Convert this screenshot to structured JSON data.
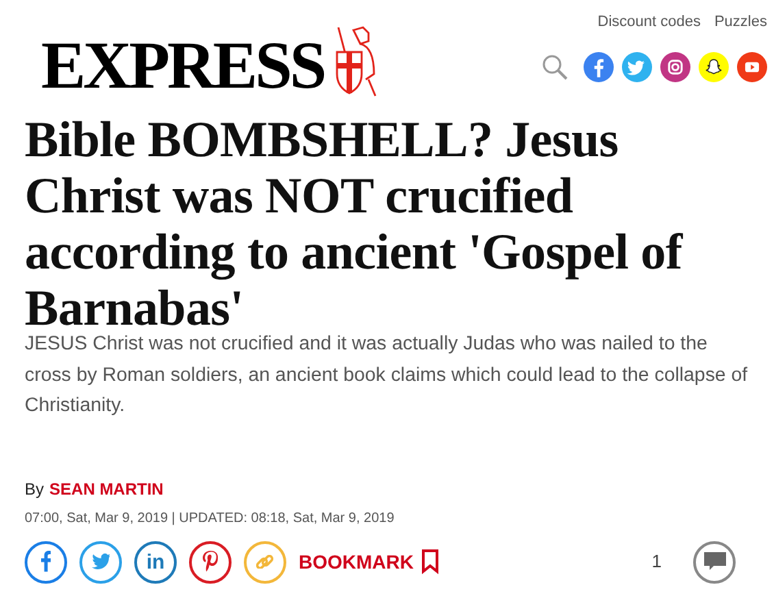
{
  "header": {
    "logo": "EXPRESS",
    "links": [
      "Discount codes",
      "Puzzles"
    ],
    "social": [
      {
        "kind": "facebook",
        "color": "#3b82f0"
      },
      {
        "kind": "twitter",
        "color": "#2fb2ef"
      },
      {
        "kind": "instagram",
        "color": "#c13584"
      },
      {
        "kind": "snapchat",
        "color": "#fffc00"
      },
      {
        "kind": "youtube",
        "color": "#f03a17"
      }
    ]
  },
  "article": {
    "headline": "Bible BOMBSHELL? Jesus Christ was NOT crucified according to ancient 'Gospel of Barnabas'",
    "standfirst": "JESUS Christ was not crucified and it was actually Judas who was nailed to the cross by Roman soldiers, an ancient book claims which could lead to the collapse of Christianity.",
    "byline_prefix": "By",
    "author": "SEAN MARTIN",
    "date": "07:00, Sat, Mar 9, 2019 | UPDATED: 08:18, Sat, Mar 9, 2019",
    "share": [
      {
        "kind": "facebook",
        "color": "#1a7ee6"
      },
      {
        "kind": "twitter",
        "color": "#2ba0e8"
      },
      {
        "kind": "linkedin",
        "color": "#1e7ab8",
        "label": "in"
      },
      {
        "kind": "pinterest",
        "color": "#d91c24"
      },
      {
        "kind": "link",
        "color": "#f3b73a"
      }
    ],
    "bookmark": "BOOKMARK",
    "comment_count": "1"
  }
}
